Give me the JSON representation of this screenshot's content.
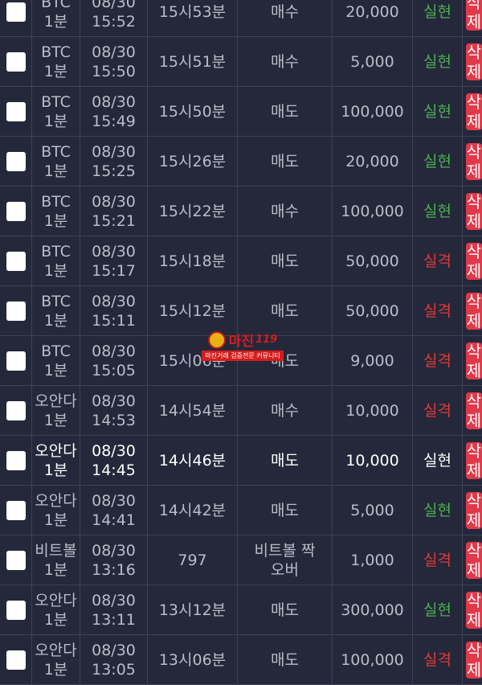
{
  "rows": [
    {
      "game": [
        "BTC",
        "1분"
      ],
      "date": [
        "08/30",
        "15:52"
      ],
      "round": "15시53분",
      "pick": [
        "매수"
      ],
      "amount": "20,000",
      "result": "실현",
      "result_type": "win",
      "action": "삭제"
    },
    {
      "game": [
        "BTC",
        "1분"
      ],
      "date": [
        "08/30",
        "15:50"
      ],
      "round": "15시51분",
      "pick": [
        "매수"
      ],
      "amount": "5,000",
      "result": "실현",
      "result_type": "win",
      "action": "삭제"
    },
    {
      "game": [
        "BTC",
        "1분"
      ],
      "date": [
        "08/30",
        "15:49"
      ],
      "round": "15시50분",
      "pick": [
        "매도"
      ],
      "amount": "100,000",
      "result": "실현",
      "result_type": "win",
      "action": "삭제"
    },
    {
      "game": [
        "BTC",
        "1분"
      ],
      "date": [
        "08/30",
        "15:25"
      ],
      "round": "15시26분",
      "pick": [
        "매도"
      ],
      "amount": "20,000",
      "result": "실현",
      "result_type": "win",
      "action": "삭제"
    },
    {
      "game": [
        "BTC",
        "1분"
      ],
      "date": [
        "08/30",
        "15:21"
      ],
      "round": "15시22분",
      "pick": [
        "매수"
      ],
      "amount": "100,000",
      "result": "실현",
      "result_type": "win",
      "action": "삭제"
    },
    {
      "game": [
        "BTC",
        "1분"
      ],
      "date": [
        "08/30",
        "15:17"
      ],
      "round": "15시18분",
      "pick": [
        "매도"
      ],
      "amount": "50,000",
      "result": "실격",
      "result_type": "lose",
      "action": "삭제"
    },
    {
      "game": [
        "BTC",
        "1분"
      ],
      "date": [
        "08/30",
        "15:11"
      ],
      "round": "15시12분",
      "pick": [
        "매도"
      ],
      "amount": "50,000",
      "result": "실격",
      "result_type": "lose",
      "action": "삭제"
    },
    {
      "game": [
        "BTC",
        "1분"
      ],
      "date": [
        "08/30",
        "15:05"
      ],
      "round": "15시06분",
      "pick": [
        "매도"
      ],
      "amount": "9,000",
      "result": "실격",
      "result_type": "lose",
      "action": "삭제"
    },
    {
      "game": [
        "오안다",
        "1분"
      ],
      "date": [
        "08/30",
        "14:53"
      ],
      "round": "14시54분",
      "pick": [
        "매수"
      ],
      "amount": "10,000",
      "result": "실격",
      "result_type": "lose",
      "action": "삭제"
    },
    {
      "game": [
        "오안다",
        "1분"
      ],
      "date": [
        "08/30",
        "14:45"
      ],
      "round": "14시46분",
      "pick": [
        "매도"
      ],
      "amount": "10,000",
      "result": "실현",
      "result_type": "win",
      "action": "삭제",
      "highlight": true
    },
    {
      "game": [
        "오안다",
        "1분"
      ],
      "date": [
        "08/30",
        "14:41"
      ],
      "round": "14시42분",
      "pick": [
        "매도"
      ],
      "amount": "5,000",
      "result": "실현",
      "result_type": "win",
      "action": "삭제"
    },
    {
      "game": [
        "비트볼",
        "1분"
      ],
      "date": [
        "08/30",
        "13:16"
      ],
      "round": "797",
      "pick": [
        "비트볼 짝",
        "오버"
      ],
      "amount": "1,000",
      "result": "실격",
      "result_type": "lose",
      "action": "삭제"
    },
    {
      "game": [
        "오안다",
        "1분"
      ],
      "date": [
        "08/30",
        "13:11"
      ],
      "round": "13시12분",
      "pick": [
        "매도"
      ],
      "amount": "300,000",
      "result": "실현",
      "result_type": "win",
      "action": "삭제"
    },
    {
      "game": [
        "오안다",
        "1분"
      ],
      "date": [
        "08/30",
        "13:05"
      ],
      "round": "13시06분",
      "pick": [
        "매도"
      ],
      "amount": "100,000",
      "result": "실격",
      "result_type": "lose",
      "action": "삭제"
    }
  ],
  "watermark": {
    "main": "마진",
    "number": "119",
    "sub": "마진거래 검증전문 커뮤니티"
  },
  "colors": {
    "win": "#4caf50",
    "lose": "#e53935",
    "delete_button": "#e0394a",
    "background": "#24283a"
  }
}
